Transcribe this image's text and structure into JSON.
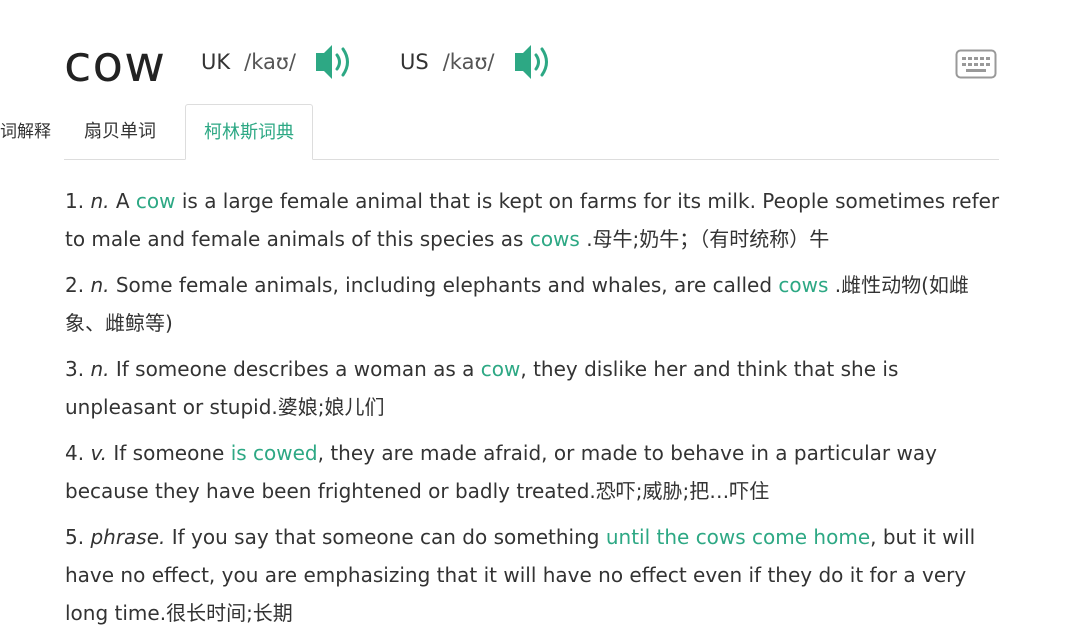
{
  "entry": {
    "word": "cow",
    "uk_label": "UK",
    "uk_phonetic": "/kaʊ/",
    "us_label": "US",
    "us_phonetic": "/kaʊ/"
  },
  "icons": {
    "speaker": "speaker-icon",
    "keyboard": "keyboard-icon"
  },
  "tabs": {
    "side": "词解释",
    "shanbay": "扇贝单词",
    "collins": "柯林斯词典"
  },
  "colors": {
    "accent": "#2da884",
    "text": "#333333",
    "border": "#dddddd"
  },
  "definitions": [
    {
      "num": "1.",
      "pos": "n.",
      "t1": " A ",
      "l1": "cow",
      "t2": " is a large female animal that is kept on farms for its milk. People sometimes refer to male and female animals of this species as ",
      "l2": "cows",
      "t3": " .母牛;奶牛；（有时统称）牛"
    },
    {
      "num": "2.",
      "pos": "n.",
      "t1": " Some female animals, including elephants and whales, are called ",
      "l1": "cows",
      "t2": " .雌性动物(如雌象、雌鲸等)"
    },
    {
      "num": "3.",
      "pos": "n.",
      "t1": " If someone describes a woman as a ",
      "l1": "cow",
      "t2": ", they dislike her and think that she is unpleasant or stupid.婆娘;娘儿们"
    },
    {
      "num": "4.",
      "pos": "v.",
      "t1": " If someone ",
      "l1": "is cowed",
      "t2": ", they are made afraid, or made to behave in a particular way because they have been frightened or badly treated.恐吓;威胁;把…吓住"
    },
    {
      "num": "5.",
      "pos": "phrase.",
      "t1": " If you say that someone can do something ",
      "l1": "until the cows come home",
      "t2": ", but it will have no effect, you are emphasizing that it will have no effect even if they do it for a very long time.很长时间;长期"
    }
  ]
}
